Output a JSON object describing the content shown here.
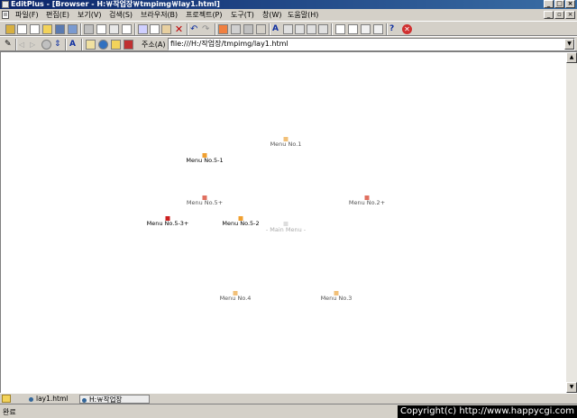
{
  "window": {
    "title": "EditPlus - [Browser - H:￦작업장￦tmpimg￦lay1.html]",
    "minimize": "_",
    "maximize": "□",
    "close": "×"
  },
  "menubar": {
    "items": [
      "파일(F)",
      "편집(E)",
      "보기(V)",
      "검색(S)",
      "브라우저(B)",
      "프로젝트(P)",
      "도구(T)",
      "창(W)",
      "도움말(H)"
    ]
  },
  "addressbar": {
    "label": "주소(A)",
    "value": "file:///H:/작업장/tmpimg/lay1.html",
    "dropdown": "▼"
  },
  "content": {
    "nodes": [
      {
        "label": "Menu No.1",
        "color": "#f2c078",
        "text_color": "#555555"
      },
      {
        "label": "Menu No.5-1",
        "color": "#f0a030",
        "text_color": "#000000"
      },
      {
        "label": "Menu No.5+",
        "color": "#e07060",
        "text_color": "#555555"
      },
      {
        "label": "Menu No.2+",
        "color": "#e07060",
        "text_color": "#555555"
      },
      {
        "label": "Menu No.5-3+",
        "color": "#cc2020",
        "text_color": "#000000"
      },
      {
        "label": "Menu No.5-2",
        "color": "#f0a030",
        "text_color": "#000000"
      },
      {
        "label": "- Main Menu -",
        "color": "#dddddd",
        "text_color": "#aaaaaa"
      },
      {
        "label": "Menu No.4",
        "color": "#f2c078",
        "text_color": "#555555"
      },
      {
        "label": "Menu No.3",
        "color": "#f2c078",
        "text_color": "#555555"
      }
    ]
  },
  "scrollbar": {
    "up": "▲",
    "down": "▼"
  },
  "tabs": [
    {
      "label": "lay1.html"
    },
    {
      "label": "H:￦작업장￦tmpim"
    }
  ],
  "status": {
    "text": "완료",
    "copyright": "Copyright(c) http://www.happycgi.com"
  }
}
